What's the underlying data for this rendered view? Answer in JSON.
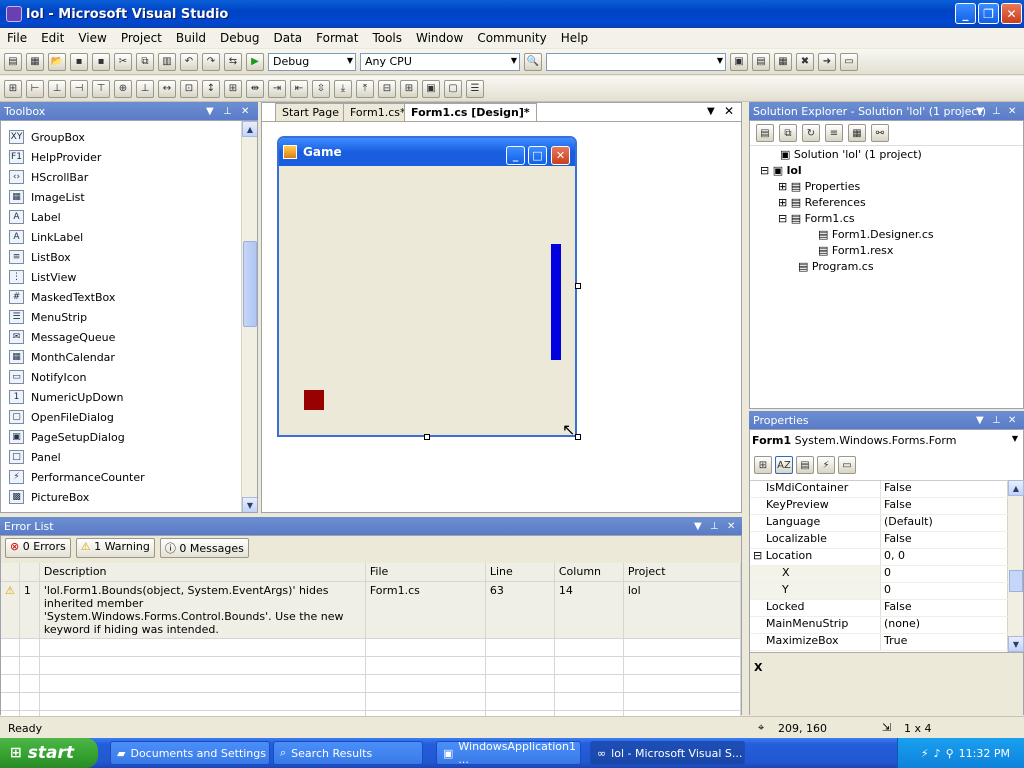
{
  "window": {
    "title": "lol - Microsoft Visual Studio"
  },
  "menu": [
    "File",
    "Edit",
    "View",
    "Project",
    "Build",
    "Debug",
    "Data",
    "Format",
    "Tools",
    "Window",
    "Community",
    "Help"
  ],
  "toolbar": {
    "config": "Debug",
    "platform": "Any CPU",
    "find": ""
  },
  "toolbox": {
    "title": "Toolbox",
    "items": [
      {
        "label": "GroupBox",
        "icon": "XY"
      },
      {
        "label": "HelpProvider",
        "icon": "F1"
      },
      {
        "label": "HScrollBar",
        "icon": "‹›"
      },
      {
        "label": "ImageList",
        "icon": "▦"
      },
      {
        "label": "Label",
        "icon": "A"
      },
      {
        "label": "LinkLabel",
        "icon": "A"
      },
      {
        "label": "ListBox",
        "icon": "≡"
      },
      {
        "label": "ListView",
        "icon": "⋮"
      },
      {
        "label": "MaskedTextBox",
        "icon": "#"
      },
      {
        "label": "MenuStrip",
        "icon": "☰"
      },
      {
        "label": "MessageQueue",
        "icon": "✉"
      },
      {
        "label": "MonthCalendar",
        "icon": "▦"
      },
      {
        "label": "NotifyIcon",
        "icon": "▭"
      },
      {
        "label": "NumericUpDown",
        "icon": "1"
      },
      {
        "label": "OpenFileDialog",
        "icon": "▢"
      },
      {
        "label": "PageSetupDialog",
        "icon": "▣"
      },
      {
        "label": "Panel",
        "icon": "□"
      },
      {
        "label": "PerformanceCounter",
        "icon": "⚡"
      },
      {
        "label": "PictureBox",
        "icon": "▩"
      }
    ]
  },
  "tabs": [
    {
      "label": "Start Page"
    },
    {
      "label": "Form1.cs*"
    },
    {
      "label": "Form1.cs [Design]*"
    }
  ],
  "designer": {
    "form_title": "Game"
  },
  "error_list": {
    "title": "Error List",
    "filters": {
      "errors": "0 Errors",
      "warnings": "1 Warning",
      "messages": "0 Messages"
    },
    "columns": [
      "",
      "Description",
      "File",
      "Line",
      "Column",
      "Project"
    ],
    "rows": [
      {
        "num": "1",
        "description": "'lol.Form1.Bounds(object, System.EventArgs)' hides inherited member 'System.Windows.Forms.Control.Bounds'. Use the new keyword if hiding was intended.",
        "file": "Form1.cs",
        "line": "63",
        "column": "14",
        "project": "lol"
      }
    ]
  },
  "solution": {
    "title": "Solution Explorer - Solution 'lol' (1 project)",
    "nodes": [
      "Solution 'lol' (1 project)",
      "lol",
      "Properties",
      "References",
      "Form1.cs",
      "Form1.Designer.cs",
      "Form1.resx",
      "Program.cs"
    ]
  },
  "properties": {
    "title": "Properties",
    "object_name": "Form1",
    "object_type": "System.Windows.Forms.Form",
    "rows": [
      {
        "name": "IsMdiContainer",
        "value": "False",
        "sub": false
      },
      {
        "name": "KeyPreview",
        "value": "False",
        "sub": false
      },
      {
        "name": "Language",
        "value": "(Default)",
        "sub": false
      },
      {
        "name": "Localizable",
        "value": "False",
        "sub": false
      },
      {
        "name": "Location",
        "value": "0, 0",
        "sub": false,
        "expanded": true
      },
      {
        "name": "X",
        "value": "0",
        "sub": true
      },
      {
        "name": "Y",
        "value": "0",
        "sub": true
      },
      {
        "name": "Locked",
        "value": "False",
        "sub": false
      },
      {
        "name": "MainMenuStrip",
        "value": "(none)",
        "sub": false
      },
      {
        "name": "MaximizeBox",
        "value": "True",
        "sub": false
      }
    ],
    "description": "X"
  },
  "status": {
    "text": "Ready",
    "position": "209, 160",
    "size": "1 x 4"
  },
  "taskbar": {
    "start": "start",
    "tasks": [
      {
        "label": "Documents and Settings"
      },
      {
        "label": "Search Results"
      },
      {
        "label": "WindowsApplication1 ..."
      },
      {
        "label": "lol - Microsoft Visual S..."
      }
    ],
    "clock": "11:32 PM"
  },
  "colors": {
    "paddle": "#0000e0",
    "block": "#990000",
    "panel_header": "#5a7bc8"
  }
}
